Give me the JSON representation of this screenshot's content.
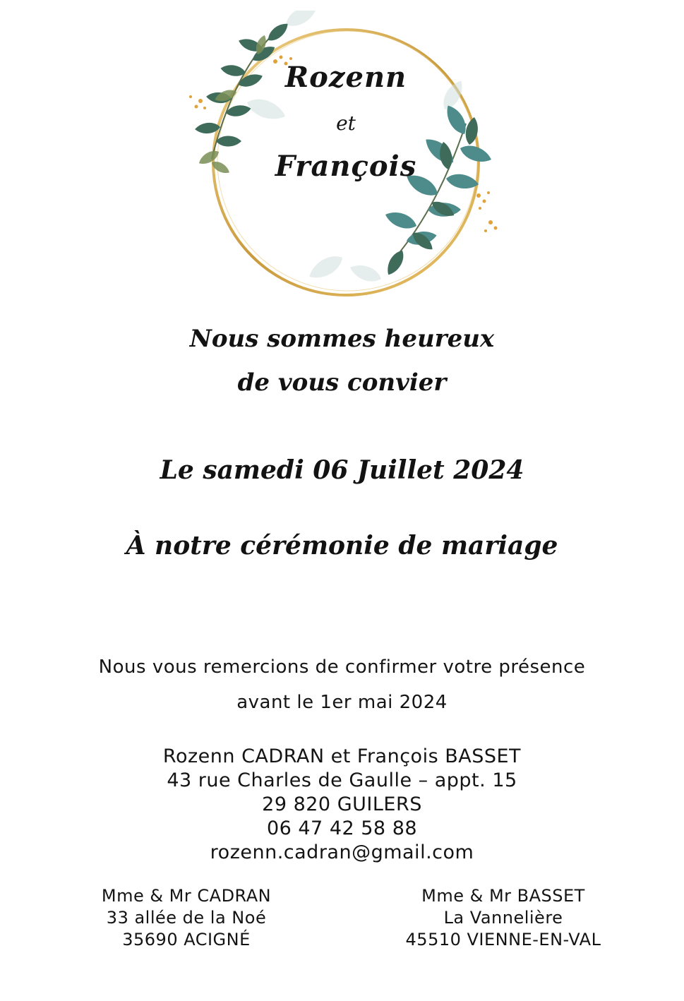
{
  "header": {
    "name_1": "Rozenn",
    "conjunction": "et",
    "name_2": "François"
  },
  "invitation": {
    "line_1": "Nous sommes heureux",
    "line_2": "de vous convier",
    "date": "Le samedi 06 Juillet 2024",
    "event": "À notre cérémonie de mariage"
  },
  "rsvp": {
    "line_1": "Nous vous remercions de confirmer votre présence",
    "line_2": "avant le 1er mai 2024"
  },
  "contact": {
    "names": "Rozenn CADRAN et François BASSET",
    "address": "43 rue Charles de Gaulle – appt. 15",
    "city": "29 820 GUILERS",
    "phone": "06 47 42 58 88",
    "email": "rozenn.cadran@gmail.com"
  },
  "families": [
    {
      "name": "Mme & Mr CADRAN",
      "address": "33 allée de la Noé",
      "city": "35690 ACIGNÉ"
    },
    {
      "name": "Mme & Mr BASSET",
      "address": "La Vannelière",
      "city": "45510 VIENNE-EN-VAL"
    }
  ],
  "colors": {
    "ring_gold": "#d4a64a",
    "leaf_dark": "#3f6b5a",
    "leaf_teal": "#4d8c8a",
    "leaf_olive": "#7a8f56",
    "berry": "#e0a23a",
    "text": "#141414"
  }
}
